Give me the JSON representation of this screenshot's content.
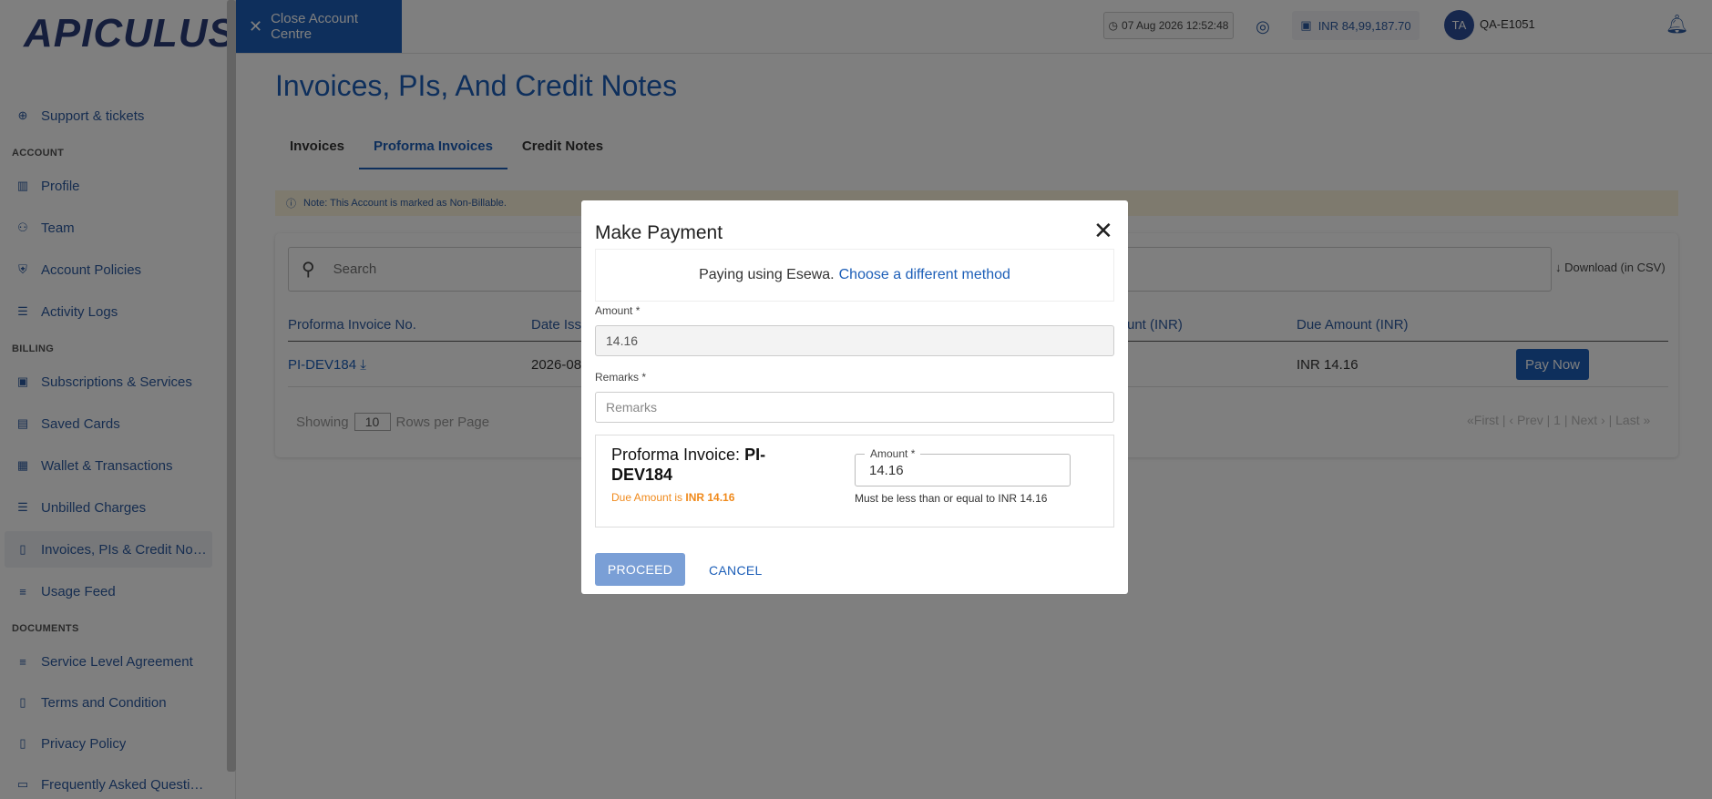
{
  "app": {
    "logo_text": "APICULUS"
  },
  "sidebar": {
    "items": [
      {
        "label": "Support & tickets",
        "icon": "lifebuoy-icon"
      },
      {
        "label": "Profile",
        "icon": "building-icon"
      },
      {
        "label": "Team",
        "icon": "team-icon"
      },
      {
        "label": "Account Policies",
        "icon": "shield-icon"
      },
      {
        "label": "Activity Logs",
        "icon": "list-icon"
      },
      {
        "label": "Subscriptions & Services",
        "icon": "briefcase-icon"
      },
      {
        "label": "Saved Cards",
        "icon": "card-icon"
      },
      {
        "label": "Wallet & Transactions",
        "icon": "wallet-icon"
      },
      {
        "label": "Unbilled Charges",
        "icon": "list-icon"
      },
      {
        "label": "Invoices, PIs & Credit Notes",
        "icon": "document-icon"
      },
      {
        "label": "Usage Feed",
        "icon": "lines-icon"
      },
      {
        "label": "Service Level Agreement",
        "icon": "doc-lines-icon"
      },
      {
        "label": "Terms and Condition",
        "icon": "document-icon"
      },
      {
        "label": "Privacy Policy",
        "icon": "document-icon"
      },
      {
        "label": "Frequently Asked Questions",
        "icon": "faq-icon"
      }
    ],
    "sections": {
      "account": "ACCOUNT",
      "billing": "BILLING",
      "documents": "DOCUMENTS"
    }
  },
  "topbar": {
    "close_label": "Close Account Centre",
    "datetime": "07 Aug 2026 12:52:48",
    "wallet_balance": "INR 84,99,187.70",
    "avatar_initials": "TA",
    "account_name": "QA-E1051"
  },
  "main": {
    "title": "Invoices, PIs, And Credit Notes",
    "tabs": [
      "Invoices",
      "Proforma Invoices",
      "Credit Notes"
    ],
    "note": "Note: This Account is marked as Non-Billable.",
    "search_placeholder": "Search",
    "download_label": "Download (in CSV)",
    "columns": [
      "Proforma Invoice No.",
      "Date Issu",
      "unt (INR)",
      "Due Amount (INR)"
    ],
    "rows": [
      {
        "pi_no": "PI-DEV184",
        "date": "2026-08-",
        "due": "INR 14.16",
        "action": "Pay Now"
      }
    ],
    "pagination": {
      "showing": "Showing",
      "rows_per_page": "10",
      "rows_label": "Rows per Page",
      "pager": "«First  |  ‹ Prev  |  1  |  Next ›  |  Last »"
    }
  },
  "modal": {
    "title": "Make Payment",
    "pay_method_text": "Paying using Esewa.",
    "pay_method_link": "Choose a different method",
    "amount_label": "Amount *",
    "amount_value": "14.16",
    "remarks_label": "Remarks *",
    "remarks_placeholder": "Remarks",
    "pi_prefix": "Proforma Invoice: ",
    "pi_number": "PI-DEV184",
    "due_prefix": "Due Amount is ",
    "due_value": "INR 14.16",
    "pi_amount_label": "Amount *",
    "pi_amount_value": "14.16",
    "pi_amount_hint": "Must be less than or equal to INR 14.16",
    "proceed_label": "PROCEED",
    "cancel_label": "CANCEL"
  }
}
